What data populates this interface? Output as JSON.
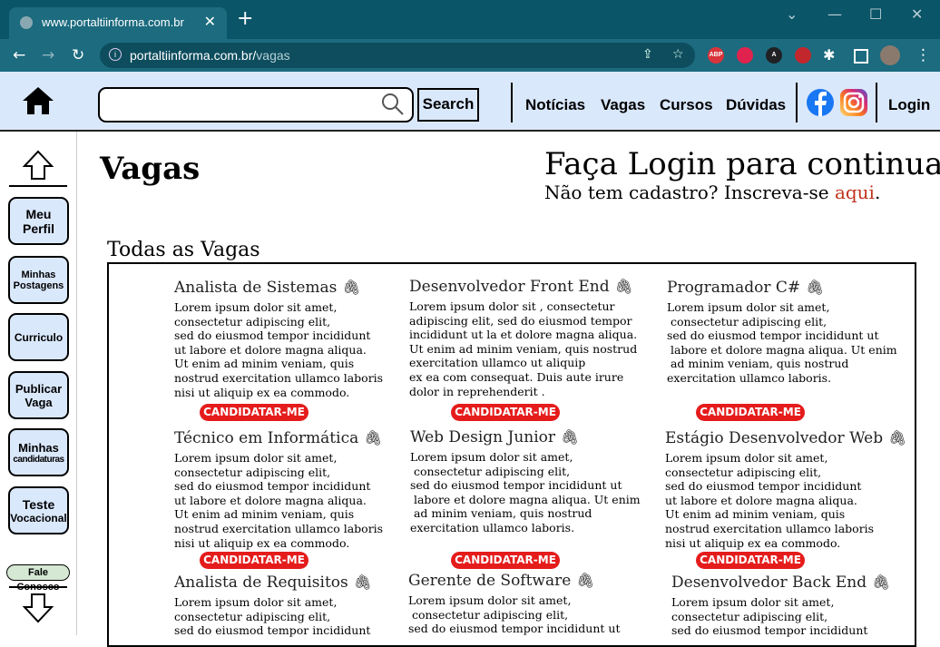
{
  "browser": {
    "tab_title": "www.portaltiinforma.com.br",
    "url_domain": "portaltiinforma.com.br/",
    "url_path": "vagas",
    "extensions": [
      {
        "name": "abp-icon",
        "label": "ABP",
        "color": "#d9343b"
      },
      {
        "name": "ublock-icon",
        "label": "",
        "color": "#e0234e"
      },
      {
        "name": "a-icon",
        "label": "A",
        "color": "#202124"
      },
      {
        "name": "fox-icon",
        "label": "",
        "color": "#c1272d"
      }
    ]
  },
  "header": {
    "search_button": "Search",
    "menu": [
      "Notícias",
      "Vagas",
      "Cursos",
      "Dúvidas"
    ],
    "login": "Login"
  },
  "sidebar": {
    "items": [
      {
        "line1": "Meu",
        "line2": "Perfil"
      },
      {
        "line1": "Minhas",
        "line2": "Postagens"
      },
      {
        "line1": "Curriculo",
        "line2": ""
      },
      {
        "line1": "Publicar",
        "line2": "Vaga"
      },
      {
        "line1": "Minhas",
        "line2": "candidaturas"
      },
      {
        "line1": "Teste",
        "line2": "Vocacional"
      }
    ],
    "contact": "Fale Conosco"
  },
  "main": {
    "title": "Vagas",
    "login_heading": "Faça Login para continuar",
    "signup_prefix": "Não tem cadastro? Inscreva-se ",
    "signup_link": "aqui",
    "signup_suffix": ".",
    "section_title": "Todas as Vagas",
    "apply_label": "CANDIDATAR-ME",
    "jobs": [
      {
        "title": "Analista de Sistemas",
        "lines": [
          "Lorem ipsum dolor sit amet,",
          "consectetur adipiscing elit,",
          "sed do eiusmod tempor incididunt",
          "ut labore et dolore magna aliqua.",
          "Ut enim ad minim veniam, quis",
          "nostrud exercitation ullamco laboris",
          "nisi ut aliquip ex ea commodo."
        ]
      },
      {
        "title": "Desenvolvedor Front End",
        "lines": [
          "Lorem ipsum dolor sit , consectetur",
          "adipiscing elit, sed do eiusmod tempor",
          "incididunt ut la et dolore magna aliqua.",
          "Ut enim ad minim veniam, quis nostrud",
          "exercitation ullamco ut aliquip",
          "ex ea com consequat. Duis aute irure",
          "dolor in reprehenderit ."
        ]
      },
      {
        "title": "Programador C#",
        "lines": [
          "Lorem ipsum dolor sit amet,",
          " consectetur adipiscing elit,",
          "sed do eiusmod tempor incididunt ut",
          " labore et dolore magna aliqua. Ut enim",
          " ad minim veniam, quis nostrud",
          "exercitation ullamco laboris."
        ]
      },
      {
        "title": "Técnico em Informática",
        "lines": [
          "Lorem ipsum dolor sit amet,",
          "consectetur adipiscing elit,",
          "sed do eiusmod tempor incididunt",
          "ut labore et dolore magna aliqua.",
          "Ut enim ad minim veniam, quis",
          "nostrud exercitation ullamco laboris",
          "nisi ut aliquip ex ea commodo."
        ]
      },
      {
        "title": "Web Design Junior",
        "lines": [
          "Lorem ipsum dolor sit amet,",
          " consectetur adipiscing elit,",
          "sed do eiusmod tempor incididunt ut",
          " labore et dolore magna aliqua. Ut enim",
          " ad minim veniam, quis nostrud",
          "exercitation ullamco laboris."
        ]
      },
      {
        "title": "Estágio Desenvolvedor Web",
        "lines": [
          "Lorem ipsum dolor sit amet,",
          "consectetur adipiscing elit,",
          "sed do eiusmod tempor incididunt",
          "ut labore et dolore magna aliqua.",
          "Ut enim ad minim veniam, quis",
          "nostrud exercitation ullamco laboris",
          "nisi ut aliquip ex ea commodo."
        ]
      },
      {
        "title": "Analista de Requisitos",
        "lines": [
          "Lorem ipsum dolor sit amet,",
          "consectetur adipiscing elit,",
          "sed do eiusmod tempor incididunt"
        ]
      },
      {
        "title": "Gerente de Software",
        "lines": [
          "Lorem ipsum dolor sit amet,",
          " consectetur adipiscing elit,",
          "sed do eiusmod tempor incididunt ut"
        ]
      },
      {
        "title": "Desenvolvedor Back End",
        "lines": [
          "Lorem ipsum dolor sit amet,",
          "consectetur adipiscing elit,",
          "sed do eiusmod tempor incididunt"
        ]
      }
    ]
  }
}
